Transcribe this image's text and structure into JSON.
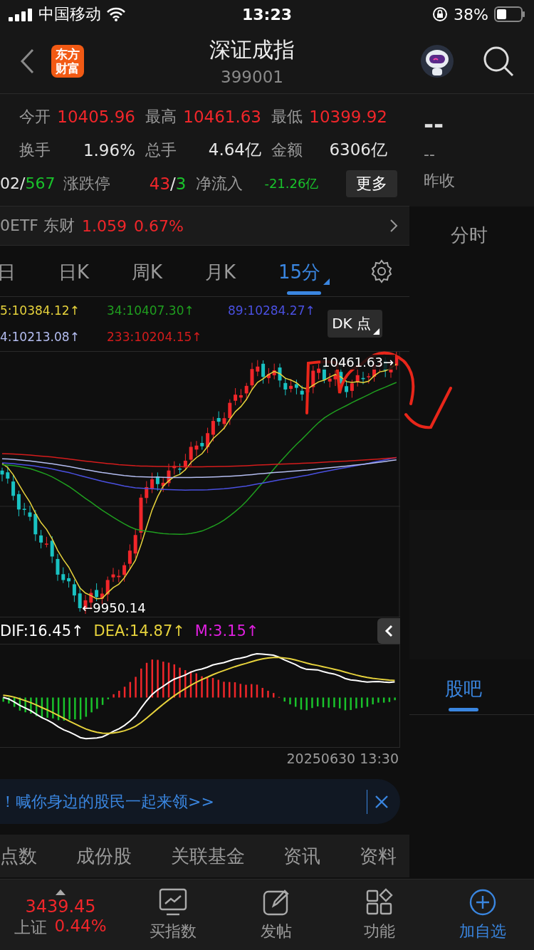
{
  "status_bar": {
    "carrier": "中国移动",
    "time": "13:23",
    "battery": "38%"
  },
  "header": {
    "logo": [
      "东方",
      "财富"
    ],
    "title": "深证成指",
    "code": "399001"
  },
  "stats": [
    {
      "cells": [
        {
          "label": "今开",
          "values": [
            {
              "text": "10405.96",
              "color": "#f0262a"
            }
          ]
        },
        {
          "label": "最高",
          "values": [
            {
              "text": "10461.63",
              "color": "#f0262a"
            }
          ]
        },
        {
          "label": "最低",
          "values": [
            {
              "text": "10399.92",
              "color": "#f0262a"
            }
          ]
        }
      ]
    },
    {
      "cells": [
        {
          "label": "换手",
          "values": [
            {
              "text": "1.96%",
              "color": "#e6e6e6"
            }
          ]
        },
        {
          "label": "总手",
          "values": [
            {
              "text": "4.64亿",
              "color": "#e6e6e6"
            }
          ]
        },
        {
          "label": "金额",
          "values": [
            {
              "text": "6306亿",
              "color": "#e6e6e6"
            }
          ]
        }
      ]
    },
    {
      "lead": [
        {
          "text": "02",
          "color": "#e6e6e6"
        },
        {
          "text": "/",
          "color": "#e6e6e6"
        },
        {
          "text": "567",
          "color": "#19c22b"
        }
      ],
      "cells": [
        {
          "label": "涨跌停",
          "values": [
            {
              "text": "43",
              "color": "#f0262a"
            },
            {
              "text": "/",
              "color": "#e6e6e6"
            },
            {
              "text": "3",
              "color": "#19c22b"
            }
          ]
        },
        {
          "label": "净流入",
          "values": [
            {
              "text": "-21.26亿",
              "color": "#19c22b"
            }
          ]
        }
      ],
      "button": "更多"
    }
  ],
  "side": {
    "price": "--",
    "value": "--",
    "prev_label": "昨收"
  },
  "etf": {
    "name": "0ETF 东财",
    "price": "1.059",
    "change": "0.67%"
  },
  "periods": [
    {
      "label": "日",
      "selected": false
    },
    {
      "label": "日K",
      "selected": false
    },
    {
      "label": "周K",
      "selected": false
    },
    {
      "label": "月K",
      "selected": false
    },
    {
      "label": "15分",
      "selected": true
    }
  ],
  "ma_legend": [
    {
      "text": "5:10384.12↑",
      "color": "#e6d23c"
    },
    {
      "text": "34:10407.30↑",
      "color": "#1f9e1f"
    },
    {
      "text": "89:10284.27↑",
      "color": "#4a50e0"
    },
    {
      "text": "4:10213.08↑",
      "color": "#b4bdf0"
    },
    {
      "text": "233:10204.15↑",
      "color": "#d41c1c"
    }
  ],
  "dk_button": "DK 点",
  "chart": {
    "high_label": "10461.63→",
    "low_label": "←9950.14"
  },
  "macd_legend": [
    {
      "text": "DIF:16.45↑",
      "color": "#ffffff"
    },
    {
      "text": "DEA:14.87↑",
      "color": "#e6d23c"
    },
    {
      "text": "M:3.15↑",
      "color": "#e020e0"
    }
  ],
  "macd_time": "20250630 13:30",
  "side_tabs": [
    {
      "label": "分时",
      "selected": false
    },
    {
      "label": "股吧",
      "selected": true
    }
  ],
  "banner": {
    "text": "！喊你身边的股民一起来领>>"
  },
  "sub_tabs": [
    "点数",
    "成份股",
    "关联基金",
    "资讯",
    "资料"
  ],
  "tab_bar": {
    "ticker": {
      "price": "3439.45",
      "name": "上证",
      "change": "0.44%"
    },
    "items": [
      {
        "label": "买指数",
        "kind": "chart",
        "selected": false
      },
      {
        "label": "发帖",
        "kind": "edit",
        "selected": false
      },
      {
        "label": "功能",
        "kind": "grid",
        "selected": false
      },
      {
        "label": "加自选",
        "kind": "plus",
        "selected": true
      }
    ]
  }
}
